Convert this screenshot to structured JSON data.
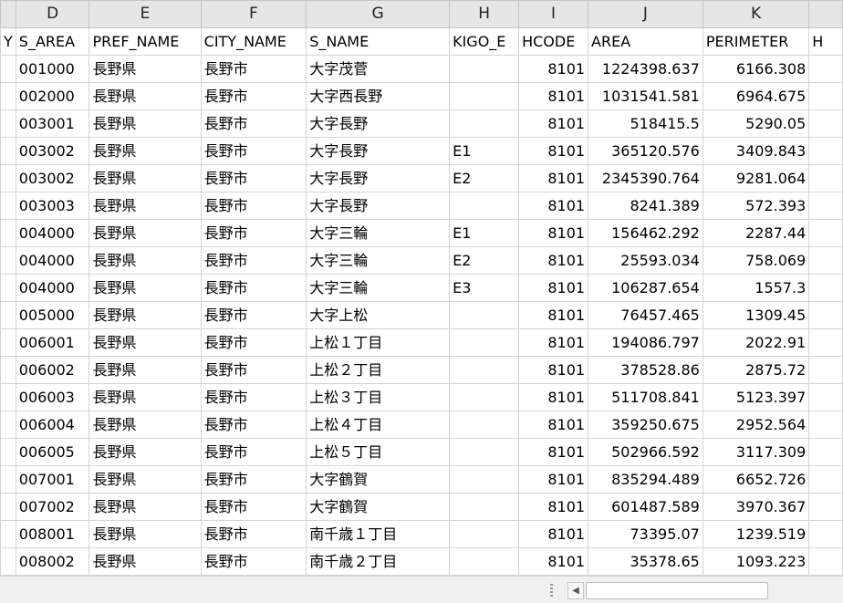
{
  "columns": [
    "",
    "D",
    "E",
    "F",
    "G",
    "H",
    "I",
    "J",
    "K",
    ""
  ],
  "header_row": [
    "Y",
    "S_AREA",
    "PREF_NAME",
    "CITY_NAME",
    "S_NAME",
    "KIGO_E",
    "HCODE",
    "AREA",
    "PERIMETER",
    "H"
  ],
  "rows": [
    [
      "001000",
      "長野県",
      "長野市",
      "大字茂菅",
      "",
      "8101",
      "1224398.637",
      "6166.308"
    ],
    [
      "002000",
      "長野県",
      "長野市",
      "大字西長野",
      "",
      "8101",
      "1031541.581",
      "6964.675"
    ],
    [
      "003001",
      "長野県",
      "長野市",
      "大字長野",
      "",
      "8101",
      "518415.5",
      "5290.05"
    ],
    [
      "003002",
      "長野県",
      "長野市",
      "大字長野",
      "E1",
      "8101",
      "365120.576",
      "3409.843"
    ],
    [
      "003002",
      "長野県",
      "長野市",
      "大字長野",
      "E2",
      "8101",
      "2345390.764",
      "9281.064"
    ],
    [
      "003003",
      "長野県",
      "長野市",
      "大字長野",
      "",
      "8101",
      "8241.389",
      "572.393"
    ],
    [
      "004000",
      "長野県",
      "長野市",
      "大字三輪",
      "E1",
      "8101",
      "156462.292",
      "2287.44"
    ],
    [
      "004000",
      "長野県",
      "長野市",
      "大字三輪",
      "E2",
      "8101",
      "25593.034",
      "758.069"
    ],
    [
      "004000",
      "長野県",
      "長野市",
      "大字三輪",
      "E3",
      "8101",
      "106287.654",
      "1557.3"
    ],
    [
      "005000",
      "長野県",
      "長野市",
      "大字上松",
      "",
      "8101",
      "76457.465",
      "1309.45"
    ],
    [
      "006001",
      "長野県",
      "長野市",
      "上松１丁目",
      "",
      "8101",
      "194086.797",
      "2022.91"
    ],
    [
      "006002",
      "長野県",
      "長野市",
      "上松２丁目",
      "",
      "8101",
      "378528.86",
      "2875.72"
    ],
    [
      "006003",
      "長野県",
      "長野市",
      "上松３丁目",
      "",
      "8101",
      "511708.841",
      "5123.397"
    ],
    [
      "006004",
      "長野県",
      "長野市",
      "上松４丁目",
      "",
      "8101",
      "359250.675",
      "2952.564"
    ],
    [
      "006005",
      "長野県",
      "長野市",
      "上松５丁目",
      "",
      "8101",
      "502966.592",
      "3117.309"
    ],
    [
      "007001",
      "長野県",
      "長野市",
      "大字鶴賀",
      "",
      "8101",
      "835294.489",
      "6652.726"
    ],
    [
      "007002",
      "長野県",
      "長野市",
      "大字鶴賀",
      "",
      "8101",
      "601487.589",
      "3970.367"
    ],
    [
      "008001",
      "長野県",
      "長野市",
      "南千歳１丁目",
      "",
      "8101",
      "73395.07",
      "1239.519"
    ],
    [
      "008002",
      "長野県",
      "長野市",
      "南千歳２丁目",
      "",
      "8101",
      "35378.65",
      "1093.223"
    ]
  ],
  "scrollbar": {
    "left_arrow": "◀"
  }
}
